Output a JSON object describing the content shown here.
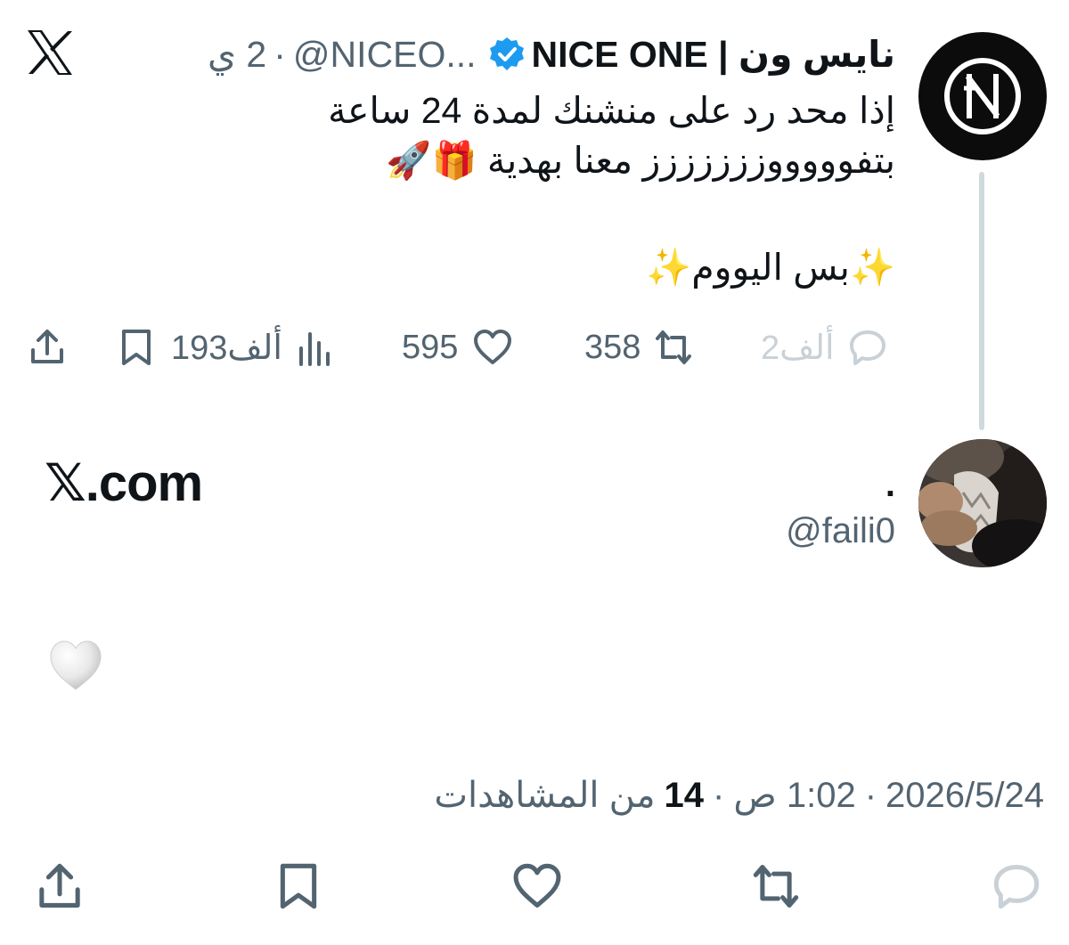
{
  "parent_tweet": {
    "display_name": "نايس ون | NICE ONE",
    "handle": "@NICEO...",
    "time_ago": "2 ي",
    "text_lines": [
      "إذا محد رد على منشنك لمدة 24 ساعة",
      "بتفوووووززززززز معنا بهدية 🎁🚀",
      "✨بس اليووم✨"
    ],
    "stats": {
      "replies": "2ألف",
      "retweets": "358",
      "likes": "595",
      "views": "193ألف"
    }
  },
  "reply_tweet": {
    "display_name": ".",
    "handle": "@faili0",
    "text": "𝕏.com",
    "date": "2026/5/24",
    "time": "1:02 ص",
    "views_count": "14",
    "views_label": "من المشاهدات"
  },
  "colors": {
    "text_primary": "#0f1419",
    "text_secondary": "#536471",
    "verified_blue": "#1d9bf0",
    "thread_line": "#cfd9de"
  }
}
